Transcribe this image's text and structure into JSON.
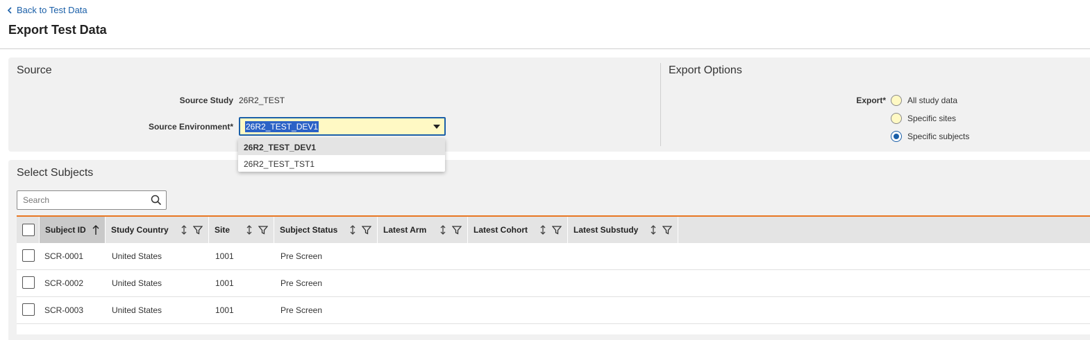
{
  "header": {
    "back_label": "Back to Test Data",
    "title": "Export Test Data"
  },
  "source": {
    "title": "Source",
    "study_label": "Source Study",
    "study_value": "26R2_TEST",
    "env_label": "Source Environment*",
    "env_value": "26R2_TEST_DEV1",
    "env_options": [
      "26R2_TEST_DEV1",
      "26R2_TEST_TST1"
    ]
  },
  "export_options": {
    "title": "Export Options",
    "export_label": "Export*",
    "options": [
      "All study data",
      "Specific sites",
      "Specific subjects"
    ],
    "selected": "Specific subjects"
  },
  "subjects": {
    "title": "Select Subjects",
    "search_placeholder": "Search",
    "columns": [
      "Subject ID",
      "Study Country",
      "Site",
      "Subject Status",
      "Latest Arm",
      "Latest Cohort",
      "Latest Substudy"
    ],
    "sorted_column": "Subject ID",
    "rows": [
      {
        "subject_id": "SCR-0001",
        "country": "United States",
        "site": "1001",
        "status": "Pre Screen"
      },
      {
        "subject_id": "SCR-0002",
        "country": "United States",
        "site": "1001",
        "status": "Pre Screen"
      },
      {
        "subject_id": "SCR-0003",
        "country": "United States",
        "site": "1001",
        "status": "Pre Screen"
      }
    ]
  },
  "colors": {
    "link": "#1a5fa8",
    "accent": "#e87722",
    "panel_bg": "#f1f1f1",
    "highlight_field": "#fff9c4"
  }
}
